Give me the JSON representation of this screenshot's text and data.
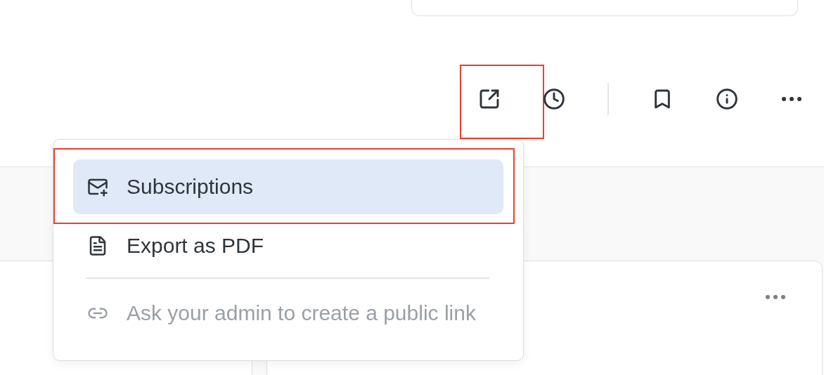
{
  "toolbar": {
    "buttons": [
      {
        "kind": "share",
        "annotated": true
      },
      {
        "kind": "history",
        "annotated": false
      },
      {
        "kind": "divider"
      },
      {
        "kind": "bookmark",
        "annotated": false
      },
      {
        "kind": "info",
        "annotated": false
      },
      {
        "kind": "more",
        "annotated": false
      }
    ]
  },
  "menu": {
    "items": [
      {
        "kind": "subscriptions",
        "label": "Subscriptions",
        "selected": true,
        "disabled": false,
        "annotated": true
      },
      {
        "kind": "export",
        "label": "Export as PDF",
        "selected": false,
        "disabled": false,
        "annotated": false
      },
      {
        "kind": "divider"
      },
      {
        "kind": "link",
        "label": "Ask your admin to create a public link",
        "selected": false,
        "disabled": true,
        "annotated": false
      }
    ]
  }
}
